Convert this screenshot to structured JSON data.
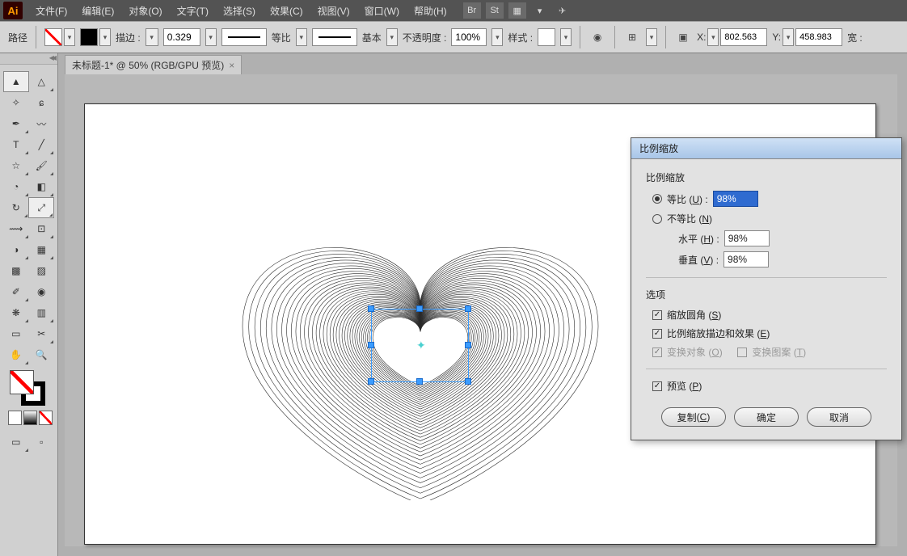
{
  "menu": {
    "file": "文件(F)",
    "edit": "编辑(E)",
    "object": "对象(O)",
    "type": "文字(T)",
    "select": "选择(S)",
    "effect": "效果(C)",
    "view": "视图(V)",
    "window": "窗口(W)",
    "help": "帮助(H)"
  },
  "optbar": {
    "label": "路径",
    "stroke_label": "描边 :",
    "stroke_val": "0.329",
    "ratio_label": "等比",
    "basic_label": "基本",
    "opacity_label": "不透明度 :",
    "opacity_val": "100%",
    "style_label": "样式 :",
    "x_label": "X:",
    "x_val": "802.563",
    "y_label": "Y:",
    "y_val": "458.983",
    "w_label": "宽 :"
  },
  "tab": {
    "title": "未标题-1* @ 50% (RGB/GPU 预览)"
  },
  "dialog": {
    "title": "比例缩放",
    "section_scale": "比例缩放",
    "uniform": "等比",
    "uniform_key": "U",
    "uniform_val": "98%",
    "nonuniform": "不等比",
    "nonuniform_key": "N",
    "horiz": "水平",
    "horiz_key": "H",
    "horiz_val": "98%",
    "vert": "垂直",
    "vert_key": "V",
    "vert_val": "98%",
    "section_opt": "选项",
    "corner": "缩放圆角",
    "corner_key": "S",
    "strokeeff": "比例缩放描边和效果",
    "strokeeff_key": "E",
    "transobj": "变换对象",
    "transobj_key": "O",
    "transpat": "变换图案",
    "transpat_key": "T",
    "preview": "预览",
    "preview_key": "P",
    "copy": "复制",
    "copy_key": "C",
    "ok": "确定",
    "cancel": "取消"
  }
}
